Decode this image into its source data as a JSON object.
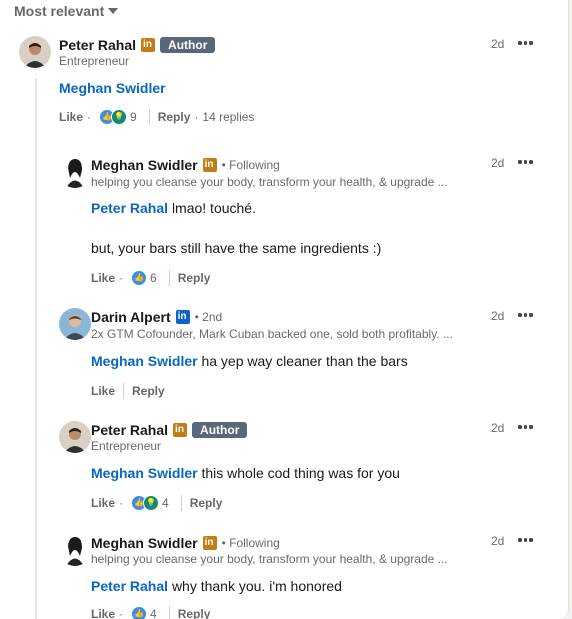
{
  "sort": {
    "label": "Most relevant"
  },
  "colors": {
    "mention": "#0a66c2",
    "author_badge": "#56687a",
    "li_gold": "#c37d16",
    "li_blue": "#0a66c2"
  },
  "top_comment": {
    "name": "Peter Rahal",
    "badge": "Author",
    "subtitle": "Entrepreneur",
    "time": "2d",
    "mention": "Meghan Swidler",
    "like": "Like",
    "react_count": "9",
    "reply": "Reply",
    "replies": "14 replies"
  },
  "replies": [
    {
      "name": "Meghan Swidler",
      "meta": "• Following",
      "subtitle": "helping you cleanse your body, transform your health, & upgrade ...",
      "time": "2d",
      "mention": "Peter Rahal",
      "text": "lmao! touché.",
      "text2": "but, your bars still have the same ingredients :)",
      "like": "Like",
      "react_count": "6",
      "reply": "Reply"
    },
    {
      "name": "Darin Alpert",
      "meta": "• 2nd",
      "subtitle": "2x GTM Cofounder, Mark Cuban backed one, sold both profitably. ...",
      "time": "2d",
      "mention": "Meghan Swidler",
      "text": "ha yep way cleaner than the bars",
      "like": "Like",
      "reply": "Reply"
    },
    {
      "name": "Peter Rahal",
      "badge": "Author",
      "subtitle": "Entrepreneur",
      "time": "2d",
      "mention": "Meghan Swidler",
      "text": "this whole cod thing was for you",
      "like": "Like",
      "react_count": "4",
      "reply": "Reply"
    },
    {
      "name": "Meghan Swidler",
      "meta": "• Following",
      "subtitle": "helping you cleanse your body, transform your health, & upgrade ...",
      "time": "2d",
      "mention": "Peter Rahal",
      "text": "why thank you. i'm honored",
      "like": "Like",
      "react_count": "4",
      "reply": "Reply"
    }
  ]
}
